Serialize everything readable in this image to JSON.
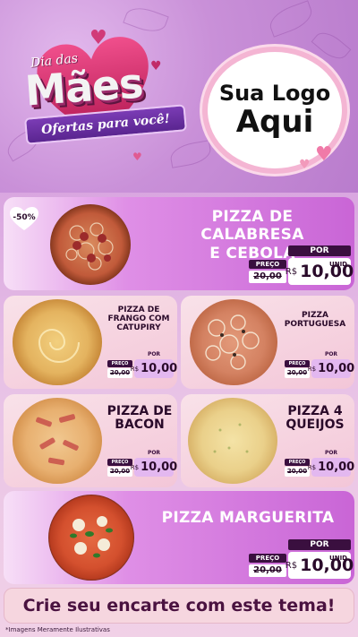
{
  "header": {
    "title_small": "Dia das",
    "title_big": "Mães",
    "subtitle": "Ofertas para você!",
    "logo_line1": "Sua Logo",
    "logo_line2": "Aqui"
  },
  "labels": {
    "preco": "PREÇO",
    "por": "POR",
    "unid": "UNID",
    "currency": "R$"
  },
  "products": [
    {
      "name_lines": [
        "PIZZA DE CALABRESA",
        "E CEBOLA"
      ],
      "old_price": "20,00",
      "price": "10,00",
      "discount": "-50%",
      "pizza": "calabresa"
    },
    {
      "name_lines": [
        "PIZZA DE",
        "FRANGO COM",
        "CATUPIRY"
      ],
      "old_price": "20,00",
      "price": "10,00",
      "pizza": "frango"
    },
    {
      "name_lines": [
        "PIZZA",
        "PORTUGUESA"
      ],
      "old_price": "20,00",
      "price": "10,00",
      "pizza": "portuguesa"
    },
    {
      "name_lines": [
        "PIZZA DE",
        "BACON"
      ],
      "old_price": "20,00",
      "price": "10,00",
      "pizza": "bacon"
    },
    {
      "name_lines": [
        "PIZZA 4",
        "QUEIJOS"
      ],
      "old_price": "20,00",
      "price": "10,00",
      "pizza": "queijos"
    },
    {
      "name_lines": [
        "PIZZA MARGUERITA"
      ],
      "old_price": "20,00",
      "price": "10,00",
      "pizza": "marguerita"
    }
  ],
  "cta": "Crie seu encarte com este tema!",
  "footnote": "*Imagens Meramente Ilustrativas",
  "colors": {
    "purple_dark": "#3a0f3f",
    "pink_card": "#f3c6d8",
    "violet_card": "#c965d6",
    "heart_red": "#e94e8a"
  }
}
